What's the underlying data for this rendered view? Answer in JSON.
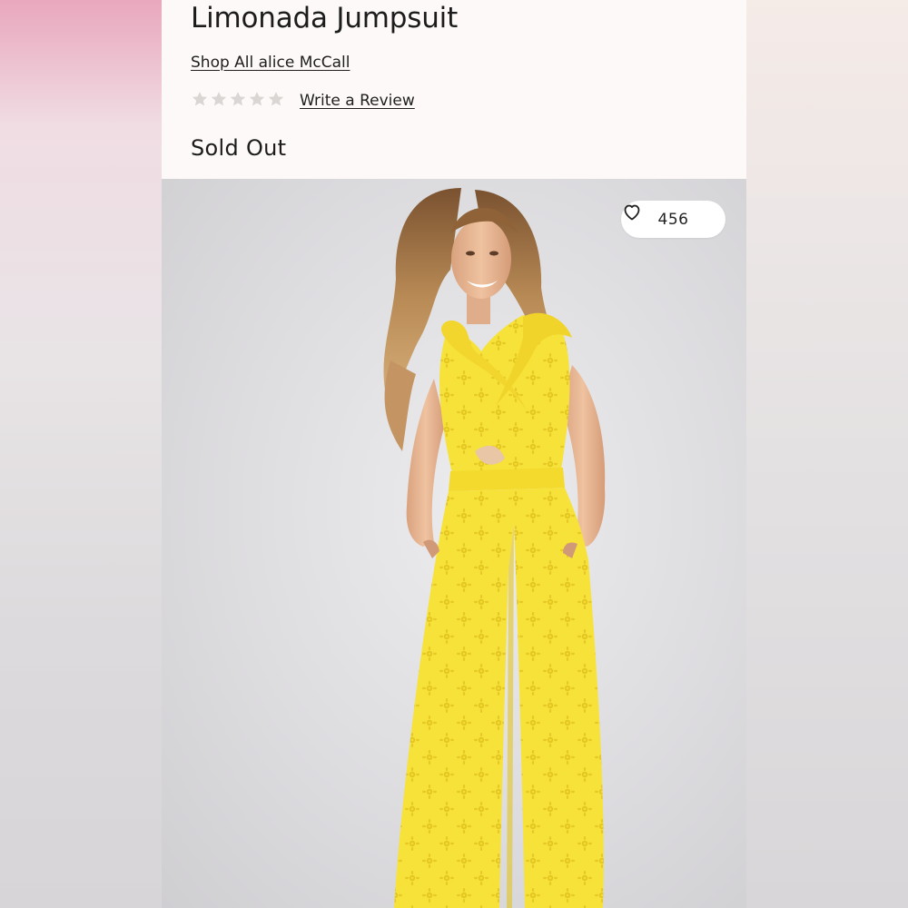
{
  "product": {
    "title": "Limonada Jumpsuit",
    "brand_link": "Shop All alice McCall",
    "rating": {
      "stars_filled": 0,
      "stars_total": 5
    },
    "review_link": "Write a Review",
    "status": "Sold Out"
  },
  "favorites": {
    "count": "456",
    "icon": "heart-outline-icon"
  },
  "colors": {
    "panel_bg": "#fdf9f8",
    "star_empty": "#d9d6d3",
    "garment": "#f7e23a"
  }
}
